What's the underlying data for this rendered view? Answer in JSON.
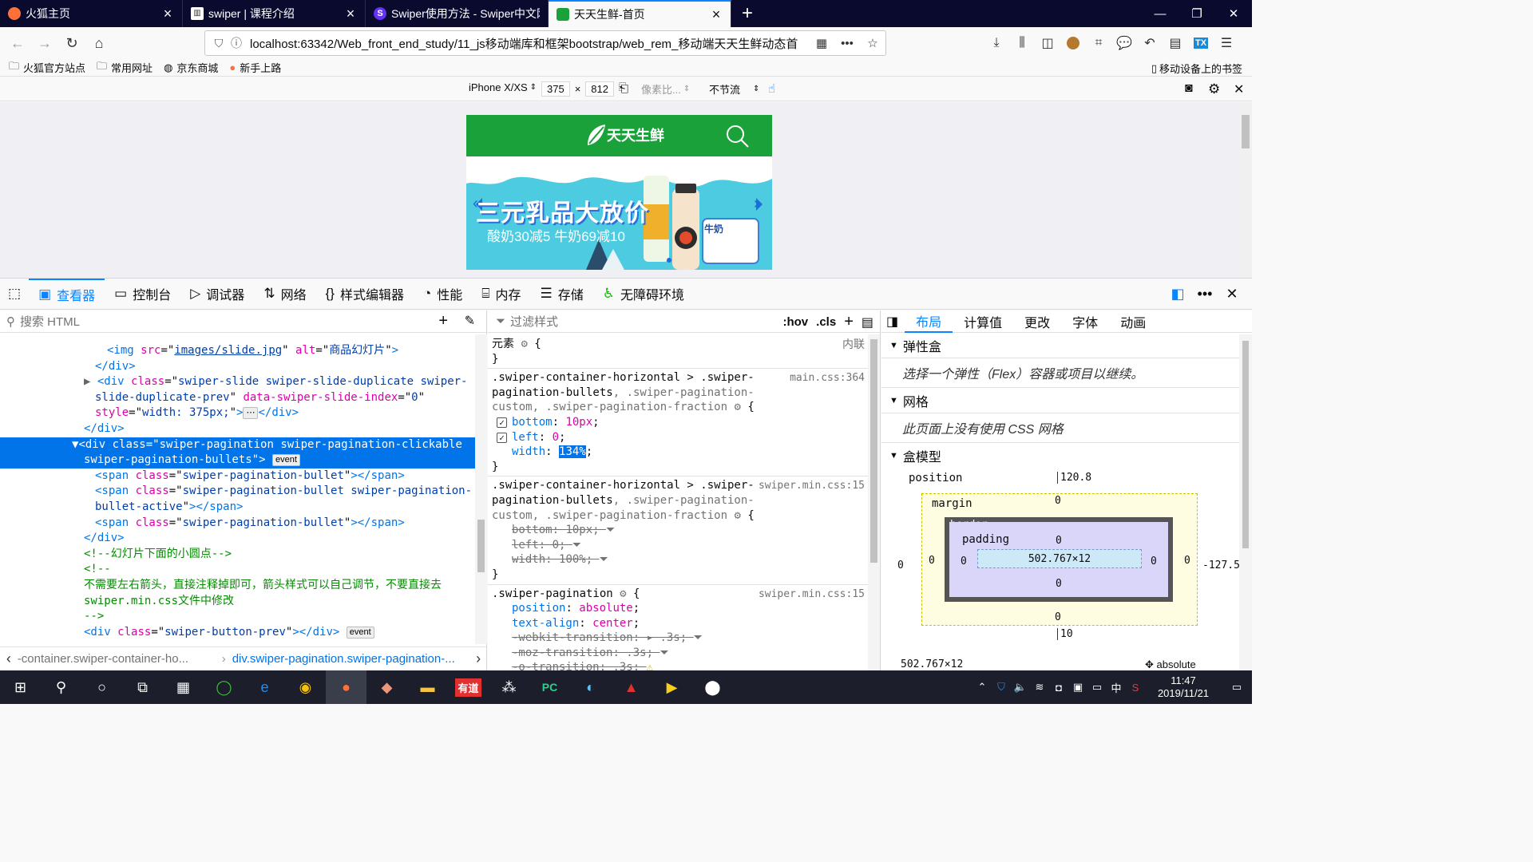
{
  "browser": {
    "tabs": [
      {
        "title": "火狐主页",
        "icon": "firefox-icon",
        "color": "#ff7139"
      },
      {
        "title": "swiper | 课程介绍",
        "icon": "book-icon",
        "color": "#333"
      },
      {
        "title": "Swiper使用方法 - Swiper中文网",
        "icon": "swiper-s-icon",
        "color": "#6332f6"
      },
      {
        "title": "天天生鲜-首页",
        "icon": "fresh-logo-icon",
        "color": "#1aa139"
      }
    ],
    "url_host": "localhost",
    "url_rest": ":63342/Web_front_end_study/11_js移动端库和框架bootstrap/web_rem_移动端天天生鲜动态首",
    "bookmarks": [
      "火狐官方站点",
      "常用网址",
      "京东商城",
      "新手上路"
    ],
    "mobile_bookmarks": "移动设备上的书签"
  },
  "rdm": {
    "device": "iPhone X/XS",
    "width": "375",
    "times": "×",
    "height": "812",
    "dpr": "像素比...",
    "throttle": "不节流"
  },
  "page": {
    "logo_text": "天天生鲜",
    "banner_headline": "三元乳品大放价",
    "banner_sub": "酸奶30减5 牛奶69减10",
    "milk_label": "牛奶"
  },
  "devtools": {
    "tabs": [
      "查看器",
      "控制台",
      "调试器",
      "网络",
      "样式编辑器",
      "性能",
      "内存",
      "存储",
      "无障碍环境"
    ],
    "search_placeholder": "搜索 HTML",
    "filter_placeholder": "过滤样式",
    "hov": ":hov",
    "cls": ".cls",
    "layout_tabs": [
      "布局",
      "计算值",
      "更改",
      "字体",
      "动画"
    ],
    "breadcrumb_1": "-container.swiper-container-ho...",
    "breadcrumb_2": "div.swiper-pagination.swiper-pagination-..."
  },
  "markup": {
    "img_line_tag": "<img ",
    "img_src_attr": "src",
    "img_src_val": "images/slide.jpg",
    "img_alt_attr": "alt",
    "img_alt_val": "商品幻灯片",
    "close_div": "</div>",
    "dup_class_val": "swiper-slide swiper-slide-duplicate swiper-",
    "dup_class_val2": "slide-duplicate-prev",
    "dup_data_attr": "data-swiper-slide-index",
    "dup_data_val": "0",
    "dup_style_val": "width: 375px;",
    "sel_class_val": "swiper-pagination swiper-pagination-clickable",
    "sel_class_val2": "swiper-pagination-bullets",
    "badge_event": "event",
    "span1_class": "swiper-pagination-bullet",
    "span2_class_a": "swiper-pagination-bullet swiper-pagination-",
    "span2_class_b": "bullet-active",
    "span3_class": "swiper-pagination-bullet",
    "comment1": "<!--幻灯片下面的小圆点-->",
    "comment2_open": "<!--",
    "comment2_text": "不需要左右箭头，直接注释掉即可，箭头样式可以自己调节，不要直接去",
    "comment2_text2": "swiper.min.css文件中修改",
    "comment2_close": "-->",
    "prev_class": "swiper-button-prev"
  },
  "rules": {
    "element_label": "元素",
    "inline_label": "内联",
    "rule1_sel": ".swiper-container-horizontal > .swiper-",
    "rule1_sel_b": "pagination-bullets",
    "rule1_sel_c": ", .swiper-pagination-",
    "rule1_sel_d": "custom, .swiper-pagination-fraction",
    "rule1_src": "main.css:364",
    "rule1_props": [
      {
        "name": "bottom",
        "value": "10px"
      },
      {
        "name": "left",
        "value": "0"
      },
      {
        "name": "width",
        "value": "134%"
      }
    ],
    "rule2_sel": ".swiper-container-horizontal > .swiper-",
    "rule2_sel_b": "pagination-bullets",
    "rule2_sel_c": ", .swiper-pagination-",
    "rule2_sel_d": "custom, .swiper-pagination-fraction",
    "rule2_src": "swiper.min.css:15",
    "rule2_props": [
      {
        "name": "bottom",
        "value": "10px"
      },
      {
        "name": "left",
        "value": "0"
      },
      {
        "name": "width",
        "value": "100%"
      }
    ],
    "rule3_sel": ".swiper-pagination",
    "rule3_src": "swiper.min.css:15",
    "rule3_props": [
      {
        "name": "position",
        "value": "absolute"
      },
      {
        "name": "text-align",
        "value": "center"
      },
      {
        "name": "-webkit-transition",
        "value": ".3s"
      },
      {
        "name": "-moz-transition",
        "value": ".3s"
      },
      {
        "name": "-o-transition",
        "value": ".3s"
      }
    ]
  },
  "layout": {
    "flex_title": "弹性盒",
    "flex_msg": "选择一个弹性（Flex）容器或项目以继续。",
    "grid_title": "网格",
    "grid_msg": "此页面上没有使用 CSS 网格",
    "box_title": "盒模型",
    "position_label": "position",
    "position_top": "120.8",
    "position_right": "-127.5",
    "position_left": "0",
    "position_bottom": "10",
    "margin_label": "margin",
    "border_label": "border",
    "padding_label": "padding",
    "zero": "0",
    "content_size": "502.767×12",
    "footer_size": "502.767×12",
    "footer_position": "absolute"
  },
  "taskbar": {
    "time": "11:47",
    "date": "2019/11/21",
    "ime": "中"
  }
}
